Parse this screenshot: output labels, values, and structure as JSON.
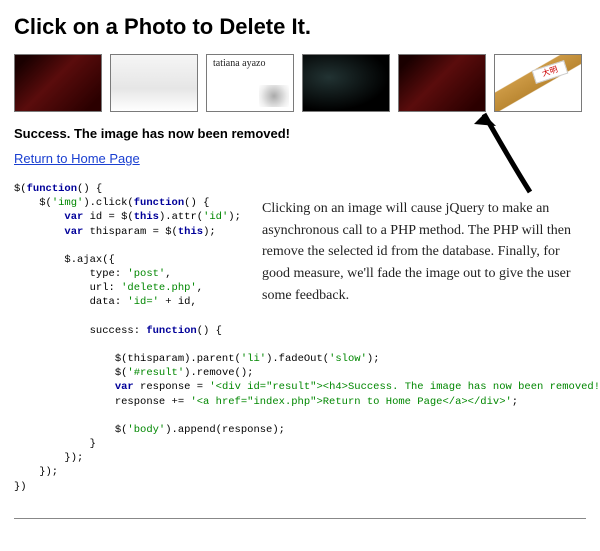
{
  "heading": "Click on a Photo to Delete It.",
  "thumbnails": [
    {
      "alt": "dark red abstract photo"
    },
    {
      "alt": "pale grey gradient photo"
    },
    {
      "alt": "white card with tatiana ayazo text",
      "label": "tatiana\nayazo"
    },
    {
      "alt": "dark world map photo"
    },
    {
      "alt": "dark red abstract photo duplicate"
    },
    {
      "alt": "angled book or sign photo",
      "label": "大明"
    }
  ],
  "status_message": "Success. The image has now been removed!",
  "home_link_label": "Return to Home Page",
  "annotation_text": "Clicking on an image will cause jQuery to make an asynchronous call to a PHP method. The PHP will then remove the selected id from the database. Finally, for good measure, we'll fade the image out to give the user some feedback.",
  "code": {
    "l01a": "$(",
    "l01b": "function",
    "l01c": "() {",
    "l02a": "    $(",
    "l02b": "'img'",
    "l02c": ").click(",
    "l02d": "function",
    "l02e": "() {",
    "l03a": "        ",
    "l03b": "var",
    "l03c": " id = $(",
    "l03d": "this",
    "l03e": ").attr(",
    "l03f": "'id'",
    "l03g": ");",
    "l04a": "        ",
    "l04b": "var",
    "l04c": " thisparam = $(",
    "l04d": "this",
    "l04e": ");",
    "l05": "",
    "l06": "        $.ajax({",
    "l07a": "            type: ",
    "l07b": "'post'",
    "l07c": ",",
    "l08a": "            url: ",
    "l08b": "'delete.php'",
    "l08c": ",",
    "l09a": "            data: ",
    "l09b": "'id='",
    "l09c": " + id,",
    "l10": "",
    "l11a": "            success: ",
    "l11b": "function",
    "l11c": "() {",
    "l12": "",
    "l13a": "                $(thisparam).parent(",
    "l13b": "'li'",
    "l13c": ").fadeOut(",
    "l13d": "'slow'",
    "l13e": ");",
    "l14a": "                $(",
    "l14b": "'#result'",
    "l14c": ").remove();",
    "l15a": "                ",
    "l15b": "var",
    "l15c": " response = ",
    "l15d": "'<div id=\"result\"><h4>Success. The image has now been removed!",
    "l16a": "                response += ",
    "l16b": "'<a href=\"index.php\">Return to Home Page</a></div>'",
    "l16c": ";",
    "l17": "",
    "l18a": "                $(",
    "l18b": "'body'",
    "l18c": ").append(response);",
    "l19": "            }",
    "l20": "        });",
    "l21": "    });",
    "l22": "})"
  }
}
